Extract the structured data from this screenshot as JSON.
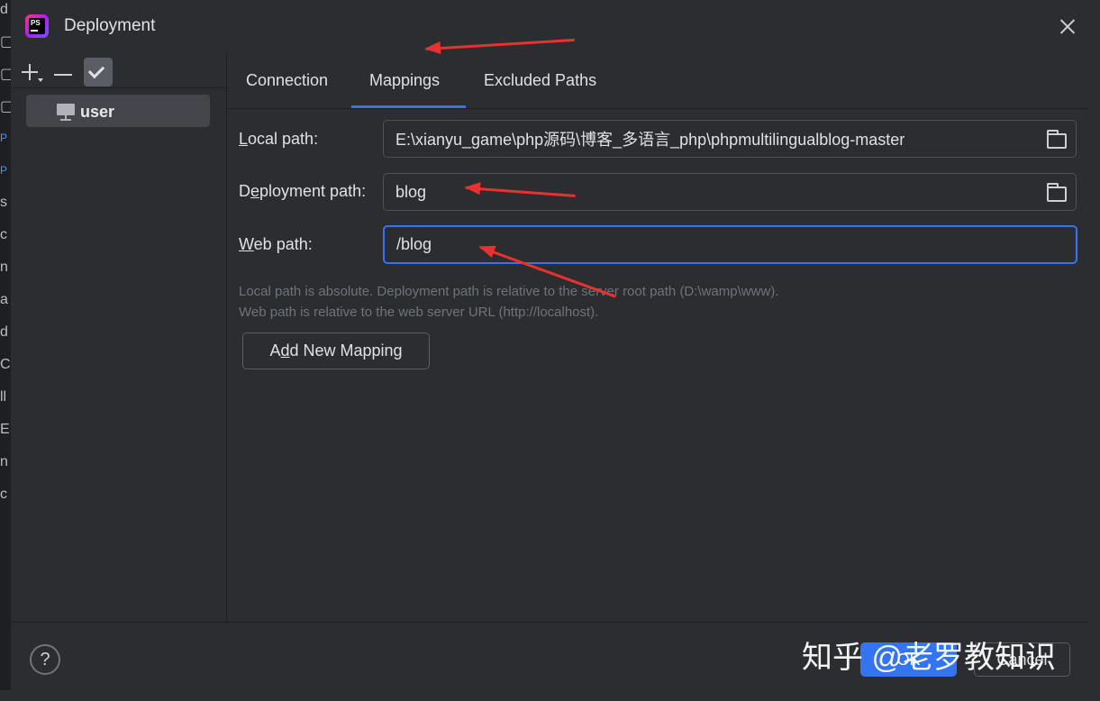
{
  "window": {
    "title": "Deployment",
    "logo_text": "PS"
  },
  "background_edge": [
    "d",
    "▢",
    "▢",
    "▢",
    "P",
    "P",
    "s",
    "c",
    "n",
    "a",
    "d",
    "C",
    "ll",
    "E",
    "n",
    "c"
  ],
  "sidebar": {
    "server_name": "user"
  },
  "tabs": [
    {
      "label": "Connection",
      "active": false
    },
    {
      "label": "Mappings",
      "active": true
    },
    {
      "label": "Excluded Paths",
      "active": false
    }
  ],
  "mapping": {
    "local_path_label_pre": "",
    "local_path_label_u": "L",
    "local_path_label_post": "ocal path:",
    "local_path_value": "E:\\xianyu_game\\php源码\\博客_多语言_php\\phpmultilingualblog-master",
    "deployment_path_label_pre": "D",
    "deployment_path_label_u": "e",
    "deployment_path_label_post": "ployment path:",
    "deployment_path_value": "blog",
    "web_path_label_pre": "",
    "web_path_label_u": "W",
    "web_path_label_post": "eb path:",
    "web_path_value": "/blog",
    "hint_line1": "Local path is absolute. Deployment path is relative to the server root path (D:\\wamp\\www).",
    "hint_line2": "Web path is relative to the web server URL (http://localhost).",
    "add_button_pre": "A",
    "add_button_u": "d",
    "add_button_post": "d New Mapping"
  },
  "footer": {
    "help_label": "?",
    "ok_label": "OK",
    "cancel_label": "Cancel",
    "watermark": "知乎 @老罗教知识"
  },
  "colors": {
    "accent": "#3574f0",
    "annotation_arrow": "#e8322f",
    "dialog_bg": "#2b2d30"
  },
  "icons": [
    "app-logo-icon",
    "close-icon",
    "plus-icon",
    "minus-icon",
    "check-icon",
    "server-icon",
    "folder-icon",
    "help-icon"
  ]
}
